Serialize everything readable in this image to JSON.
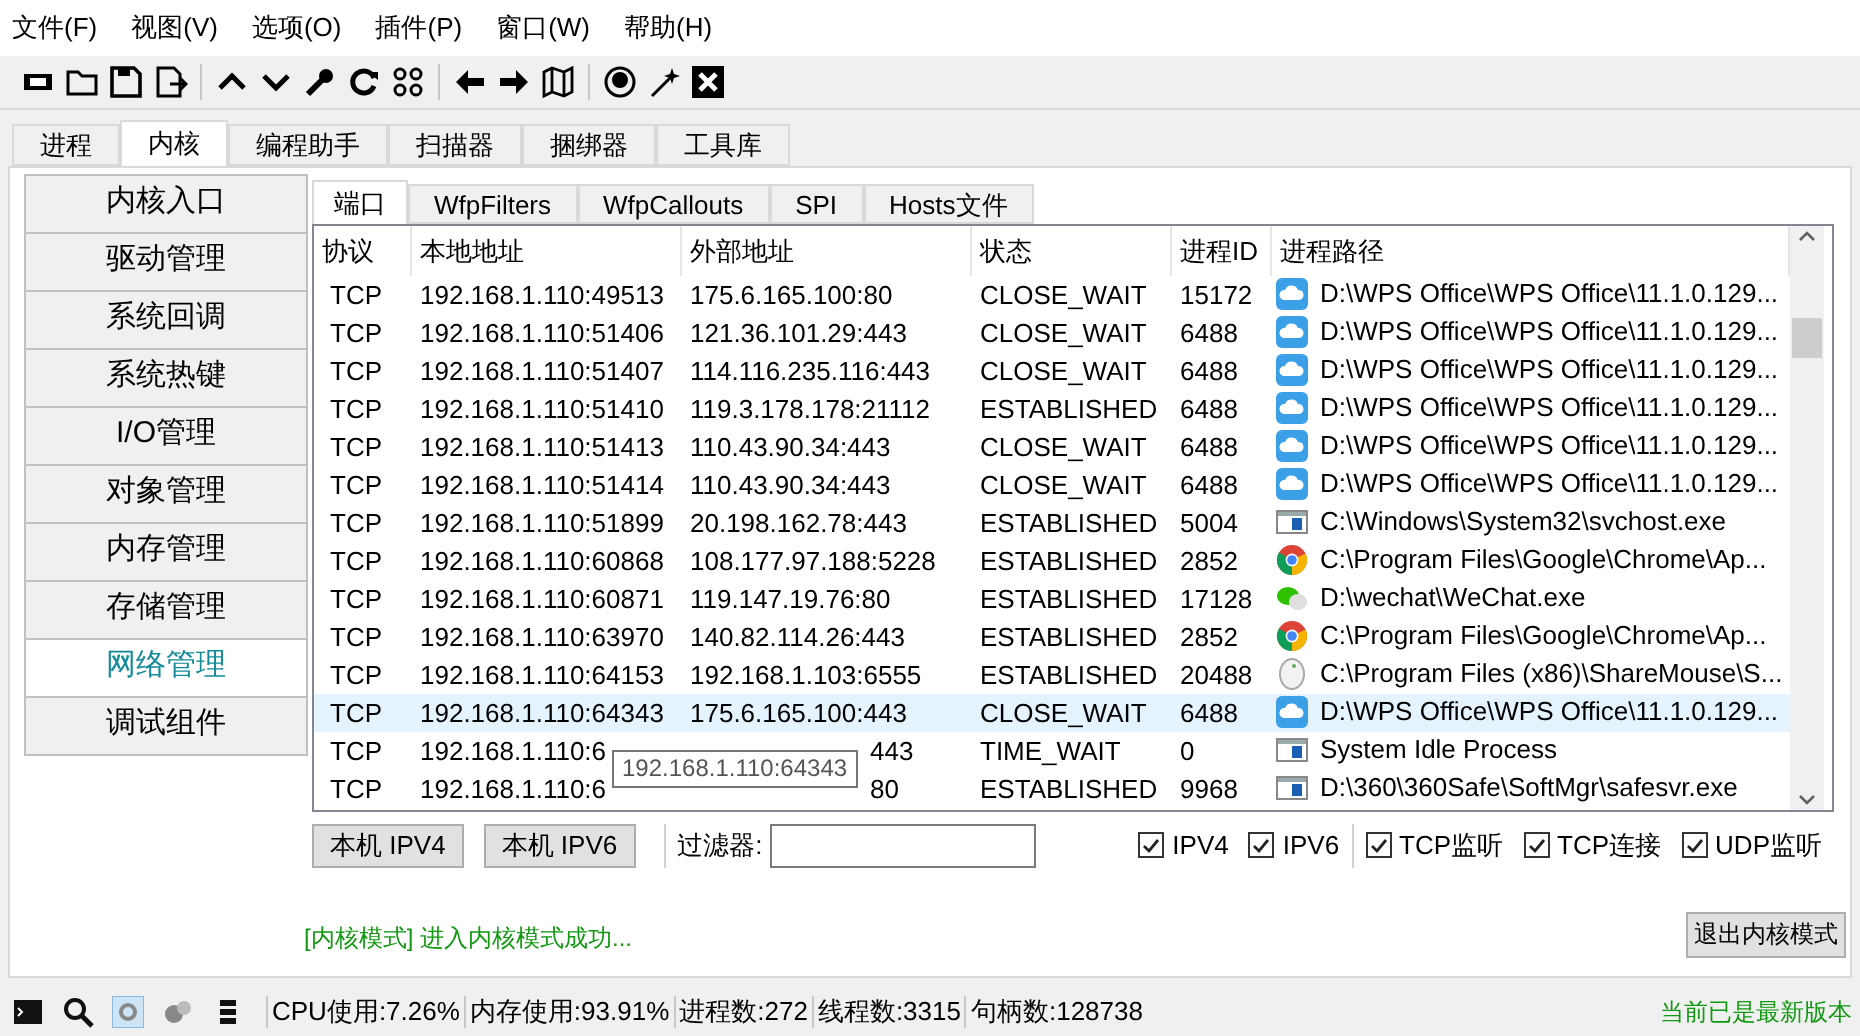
{
  "menu": [
    "文件(F)",
    "视图(V)",
    "选项(O)",
    "插件(P)",
    "窗口(W)",
    "帮助(H)"
  ],
  "main_tabs": [
    {
      "label": "进程",
      "selected": false
    },
    {
      "label": "内核",
      "selected": true
    },
    {
      "label": "编程助手",
      "selected": false
    },
    {
      "label": "扫描器",
      "selected": false
    },
    {
      "label": "捆绑器",
      "selected": false
    },
    {
      "label": "工具库",
      "selected": false
    }
  ],
  "sidebar": {
    "items": [
      {
        "label": "内核入口",
        "selected": false
      },
      {
        "label": "驱动管理",
        "selected": false
      },
      {
        "label": "系统回调",
        "selected": false
      },
      {
        "label": "系统热键",
        "selected": false
      },
      {
        "label": "I/O管理",
        "selected": false
      },
      {
        "label": "对象管理",
        "selected": false
      },
      {
        "label": "内存管理",
        "selected": false
      },
      {
        "label": "存储管理",
        "selected": false
      },
      {
        "label": "网络管理",
        "selected": true
      },
      {
        "label": "调试组件",
        "selected": false
      }
    ]
  },
  "inner_tabs": [
    {
      "label": "端口",
      "selected": true
    },
    {
      "label": "WfpFilters",
      "selected": false
    },
    {
      "label": "WfpCallouts",
      "selected": false
    },
    {
      "label": "SPI",
      "selected": false
    },
    {
      "label": "Hosts文件",
      "selected": false
    }
  ],
  "table": {
    "columns": [
      "协议",
      "本地地址",
      "外部地址",
      "状态",
      "进程ID",
      "进程路径"
    ],
    "rows": [
      {
        "protocol": "TCP",
        "local": "192.168.1.110:49513",
        "remote": "175.6.165.100:80",
        "state": "CLOSE_WAIT",
        "pid": "15172",
        "kind": "cloud",
        "path": "D:\\WPS Office\\WPS Office\\11.1.0.129...",
        "selected": false
      },
      {
        "protocol": "TCP",
        "local": "192.168.1.110:51406",
        "remote": "121.36.101.29:443",
        "state": "CLOSE_WAIT",
        "pid": "6488",
        "kind": "cloud",
        "path": "D:\\WPS Office\\WPS Office\\11.1.0.129...",
        "selected": false
      },
      {
        "protocol": "TCP",
        "local": "192.168.1.110:51407",
        "remote": "114.116.235.116:443",
        "state": "CLOSE_WAIT",
        "pid": "6488",
        "kind": "cloud",
        "path": "D:\\WPS Office\\WPS Office\\11.1.0.129...",
        "selected": false
      },
      {
        "protocol": "TCP",
        "local": "192.168.1.110:51410",
        "remote": "119.3.178.178:21112",
        "state": "ESTABLISHED",
        "pid": "6488",
        "kind": "cloud",
        "path": "D:\\WPS Office\\WPS Office\\11.1.0.129...",
        "selected": false
      },
      {
        "protocol": "TCP",
        "local": "192.168.1.110:51413",
        "remote": "110.43.90.34:443",
        "state": "CLOSE_WAIT",
        "pid": "6488",
        "kind": "cloud",
        "path": "D:\\WPS Office\\WPS Office\\11.1.0.129...",
        "selected": false
      },
      {
        "protocol": "TCP",
        "local": "192.168.1.110:51414",
        "remote": "110.43.90.34:443",
        "state": "CLOSE_WAIT",
        "pid": "6488",
        "kind": "cloud",
        "path": "D:\\WPS Office\\WPS Office\\11.1.0.129...",
        "selected": false
      },
      {
        "protocol": "TCP",
        "local": "192.168.1.110:51899",
        "remote": "20.198.162.78:443",
        "state": "ESTABLISHED",
        "pid": "5004",
        "kind": "window",
        "path": "C:\\Windows\\System32\\svchost.exe",
        "selected": false
      },
      {
        "protocol": "TCP",
        "local": "192.168.1.110:60868",
        "remote": "108.177.97.188:5228",
        "state": "ESTABLISHED",
        "pid": "2852",
        "kind": "chrome",
        "path": "C:\\Program Files\\Google\\Chrome\\Ap...",
        "selected": false
      },
      {
        "protocol": "TCP",
        "local": "192.168.1.110:60871",
        "remote": "119.147.19.76:80",
        "state": "ESTABLISHED",
        "pid": "17128",
        "kind": "chat",
        "path": "D:\\wechat\\WeChat.exe",
        "selected": false
      },
      {
        "protocol": "TCP",
        "local": "192.168.1.110:63970",
        "remote": "140.82.114.26:443",
        "state": "ESTABLISHED",
        "pid": "2852",
        "kind": "chrome",
        "path": "C:\\Program Files\\Google\\Chrome\\Ap...",
        "selected": false
      },
      {
        "protocol": "TCP",
        "local": "192.168.1.110:64153",
        "remote": "192.168.1.103:6555",
        "state": "ESTABLISHED",
        "pid": "20488",
        "kind": "mouse",
        "path": "C:\\Program Files (x86)\\ShareMouse\\S...",
        "selected": false
      },
      {
        "protocol": "TCP",
        "local": "192.168.1.110:64343",
        "remote": "175.6.165.100:443",
        "state": "CLOSE_WAIT",
        "pid": "6488",
        "kind": "cloud",
        "path": "D:\\WPS Office\\WPS Office\\11.1.0.129...",
        "selected": true
      },
      {
        "protocol": "TCP",
        "local": "192.168.1.110:6",
        "remote": "443",
        "remote_cut": true,
        "state": "TIME_WAIT",
        "pid": "0",
        "kind": "window",
        "path": "System Idle Process",
        "selected": false
      },
      {
        "protocol": "TCP",
        "local": "192.168.1.110:6",
        "remote": "80",
        "remote_cut": true,
        "state": "ESTABLISHED",
        "pid": "9968",
        "kind": "window",
        "path": "D:\\360\\360Safe\\SoftMgr\\safesvr.exe",
        "selected": false
      }
    ],
    "tooltip": "192.168.1.110:64343"
  },
  "controls": {
    "buttons": [
      "本机 IPV4",
      "本机 IPV6"
    ],
    "filter_label": "过滤器:",
    "checkboxes": [
      {
        "label": "IPV4",
        "checked": true
      },
      {
        "label": "IPV6",
        "checked": true
      },
      {
        "label": "TCP监听",
        "checked": true
      },
      {
        "label": "TCP连接",
        "checked": true
      },
      {
        "label": "UDP监听",
        "checked": true
      }
    ]
  },
  "message": "[内核模式] 进入内核模式成功...",
  "exit_button": "退出内核模式",
  "status_bar": {
    "items": [
      "CPU使用:7.26%",
      "内存使用:93.91%",
      "进程数:272",
      "线程数:3315",
      "句柄数:128738"
    ],
    "version": "当前已是最新版本"
  }
}
